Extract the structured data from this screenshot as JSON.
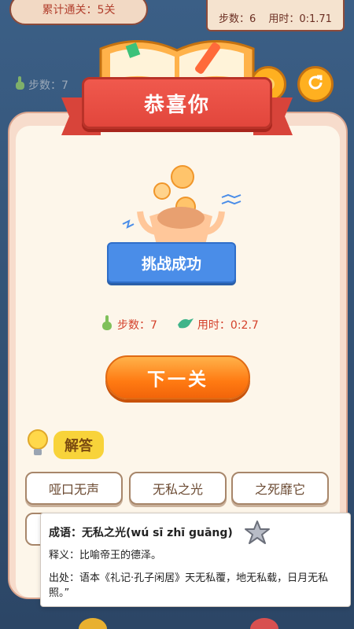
{
  "game": {
    "cumulative_levels": "累计通关：5关",
    "top_steps": "步数：6",
    "top_time": "用时：0:1.71",
    "bg_steps": "步数：7"
  },
  "modal": {
    "title": "恭喜你",
    "banner": "挑战成功",
    "steps": "步数：7",
    "time": "用时：0:2.7",
    "next_button": "下一关",
    "answer_label": "解答"
  },
  "choices": [
    "哑口无声",
    "无私之光",
    "之死靡它"
  ],
  "popup": {
    "idiom": "成语：无私之光(wú sī zhī guāng)",
    "meaning": "释义：比喻帝王的德泽。",
    "source": "出处：语本《礼记·孔子闲居》天无私覆，地无私载，日月无私照。”"
  },
  "colors": {
    "ribbon": "#e2463c",
    "next_button": "#ff7a12",
    "banner": "#4a8de8",
    "stat_text": "#d4402a",
    "answer_tag": "#f8d33a"
  },
  "icons": {
    "steps": "hand-pointer-icon",
    "time": "bird-icon",
    "hint": "lightbulb-icon",
    "refresh": "refresh-icon",
    "star": "star-icon"
  }
}
